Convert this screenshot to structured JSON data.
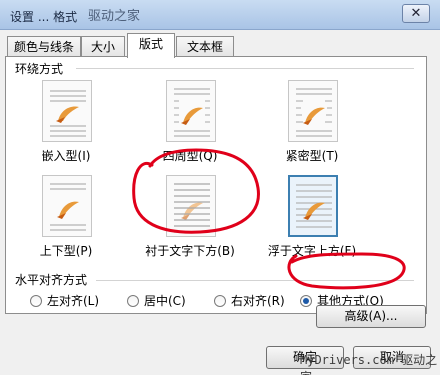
{
  "window": {
    "title": "设置 ... 格式",
    "watermark_top": "驱动之家",
    "close_glyph": "✕"
  },
  "tabs": [
    {
      "label": "颜色与线条",
      "active": false
    },
    {
      "label": "大小",
      "active": false
    },
    {
      "label": "版式",
      "active": true
    },
    {
      "label": "文本框",
      "active": false
    }
  ],
  "wrap_group": {
    "title": "环绕方式",
    "options": [
      {
        "label": "嵌入型(I)",
        "selected": false
      },
      {
        "label": "四周型(Q)",
        "selected": false
      },
      {
        "label": "紧密型(T)",
        "selected": false
      },
      {
        "label": "上下型(P)",
        "selected": false
      },
      {
        "label": "衬于文字下方(B)",
        "selected": false
      },
      {
        "label": "浮于文字上方(F)",
        "selected": true
      }
    ]
  },
  "align_group": {
    "title": "水平对齐方式",
    "options": [
      {
        "label": "左对齐(L)",
        "checked": false
      },
      {
        "label": "居中(C)",
        "checked": false
      },
      {
        "label": "右对齐(R)",
        "checked": false
      },
      {
        "label": "其他方式(O)",
        "checked": true
      }
    ]
  },
  "buttons": {
    "advanced": "高级(A)...",
    "ok": "确定",
    "cancel": "取消"
  },
  "watermark_bottom": "MyDrivers.com 驱动之家",
  "colors": {
    "selection_border": "#3c7fb1",
    "annotation_red": "#e0001a",
    "radio_accent": "#1e5aa8"
  }
}
